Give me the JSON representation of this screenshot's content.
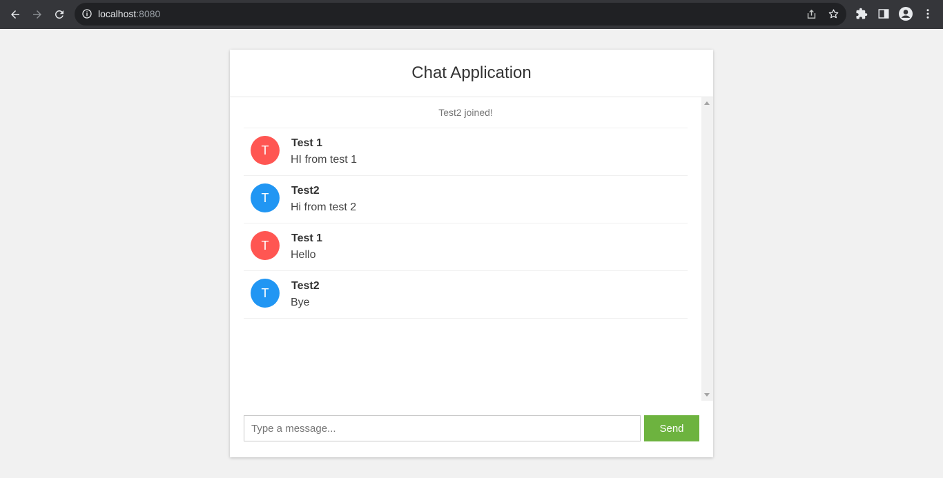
{
  "browser": {
    "url_host": "localhost",
    "url_port": ":8080"
  },
  "chat": {
    "title": "Chat Application",
    "event": "Test2 joined!",
    "messages": [
      {
        "initial": "T",
        "sender": "Test 1",
        "text": "HI from test 1",
        "color": "#ff5652"
      },
      {
        "initial": "T",
        "sender": "Test2",
        "text": "Hi from test 2",
        "color": "#2196f3"
      },
      {
        "initial": "T",
        "sender": "Test 1",
        "text": "Hello",
        "color": "#ff5652"
      },
      {
        "initial": "T",
        "sender": "Test2",
        "text": "Bye",
        "color": "#2196f3"
      }
    ],
    "input_placeholder": "Type a message...",
    "send_label": "Send"
  },
  "colors": {
    "send_button": "#6db33f",
    "avatar_red": "#ff5652",
    "avatar_blue": "#2196f3"
  }
}
